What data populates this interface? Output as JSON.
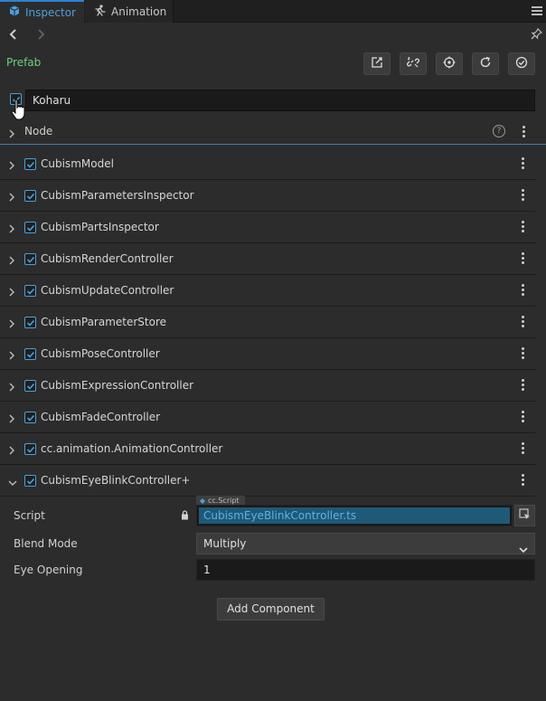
{
  "tabs": [
    {
      "label": "Inspector",
      "icon": "cube-icon",
      "active": true
    },
    {
      "label": "Animation",
      "icon": "running-figure-icon",
      "active": false
    }
  ],
  "prefab": {
    "label": "Prefab",
    "label_color": "#6bd27c",
    "toolbar_icons": [
      "open-prefab-icon",
      "unlink-prefab-icon",
      "locate-icon",
      "revert-icon",
      "apply-icon"
    ]
  },
  "node": {
    "name": "Koharu",
    "enabled": true,
    "section_label": "Node",
    "help_glyph": "?"
  },
  "components": [
    {
      "name": "CubismModel",
      "enabled": true,
      "expanded": false
    },
    {
      "name": "CubismParametersInspector",
      "enabled": true,
      "expanded": false
    },
    {
      "name": "CubismPartsInspector",
      "enabled": true,
      "expanded": false
    },
    {
      "name": "CubismRenderController",
      "enabled": true,
      "expanded": false
    },
    {
      "name": "CubismUpdateController",
      "enabled": true,
      "expanded": false
    },
    {
      "name": "CubismParameterStore",
      "enabled": true,
      "expanded": false
    },
    {
      "name": "CubismPoseController",
      "enabled": true,
      "expanded": false
    },
    {
      "name": "CubismExpressionController",
      "enabled": true,
      "expanded": false
    },
    {
      "name": "CubismFadeController",
      "enabled": true,
      "expanded": false
    },
    {
      "name": "cc.animation.AnimationController",
      "enabled": true,
      "expanded": false
    },
    {
      "name": "CubismEyeBlinkController+",
      "enabled": true,
      "expanded": true
    }
  ],
  "eye_blink": {
    "script_label": "Script",
    "script_type_tag": "cc.Script",
    "script_value": "CubismEyeBlinkController.ts",
    "blend_mode_label": "Blend Mode",
    "blend_mode_value": "Multiply",
    "eye_opening_label": "Eye Opening",
    "eye_opening_value": "1"
  },
  "add_component_label": "Add Component",
  "colors": {
    "accent": "#4aa0dc",
    "background": "#2c2c2c",
    "script_field": "#1e5a78"
  }
}
